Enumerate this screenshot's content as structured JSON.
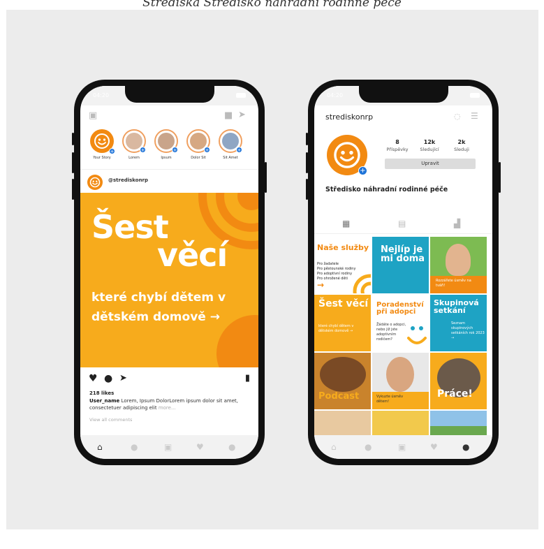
{
  "caption": "Střediska Středisko náhradní rodinné péče",
  "colors": {
    "orange": "#f7ab1c",
    "deep_orange": "#f28a12",
    "teal": "#1ea3c4",
    "blue": "#1e73d8"
  },
  "left": {
    "status_time": "04:20",
    "stories": [
      {
        "label": "Your Story"
      },
      {
        "label": "Lorem"
      },
      {
        "label": "Ipsum"
      },
      {
        "label": "Dolor Sit"
      },
      {
        "label": "Sit Amet"
      }
    ],
    "post_user": "@strediskonrp",
    "post": {
      "line1": "Šest",
      "line2": "věcí",
      "body": "které chybí dětem v dětském domově →"
    },
    "likes": "218 likes",
    "caption_user": "User_name",
    "caption_text": "Lorem, Ipsum DolorLorem ipsum dolor sit amet, consectetuer adipiscing elit",
    "caption_more": "more...",
    "view_all": "View all comments",
    "icons": [
      "camera-icon",
      "igtv-icon",
      "send-icon",
      "heart-icon",
      "comment-icon",
      "share-icon",
      "bookmark-icon",
      "home-icon",
      "search-icon",
      "add-icon",
      "activity-icon",
      "profile-icon"
    ]
  },
  "right": {
    "status_time": "04:20",
    "username": "strediskonrp",
    "stats": [
      {
        "value": "8",
        "label": "Příspěvky"
      },
      {
        "value": "12k",
        "label": "Sledující"
      },
      {
        "value": "2k",
        "label": "Sleduji"
      }
    ],
    "edit_label": "Upravit",
    "profile_title": "Středisko náhradní rodinné péče",
    "tiles": {
      "t1_title": "Naše služby",
      "t1_items": "Pro žadatele\nPro pěstounské rodiny\nPro adoptivní rodiny\nPro ohrožené děti",
      "t2_title": "Nejlíp je mi doma",
      "t3_text": "Rozzářete úsměv na tváři!",
      "t4_title": "Šest věcí",
      "t4_body": "které chybí dětem v dětském domově →",
      "t5_title": "Poradenství při adopci",
      "t5_body": "Žádáte o adopci, nebo již jste adoptivním rodičem?",
      "t6_title": "Skupinová setkání",
      "t6_body": "Seznam skupinových setkáních rok 2023 →",
      "t7_title": "Podcast",
      "t8_text": "Vykuzte úsměv dětem!",
      "t9_title": "Práce!"
    }
  }
}
